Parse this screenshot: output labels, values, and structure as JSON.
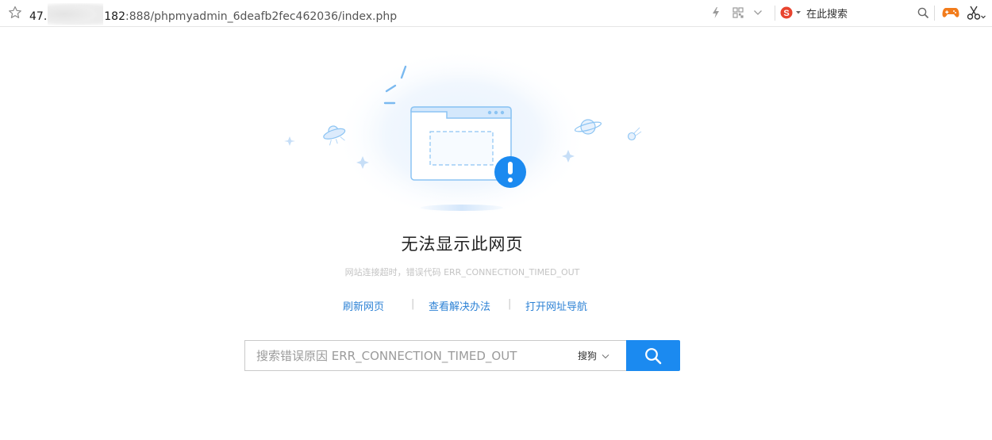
{
  "browser": {
    "url_host_prefix": "47.",
    "url_host_suffix": "182",
    "url_path": ":888/phpmyadmin_6deafb2fec462036/index.php",
    "search_engine_label": "在此搜索",
    "icons": [
      "star-icon",
      "lightning-icon",
      "qr-code-icon",
      "chevron-down-icon",
      "sogou-logo-icon",
      "search-icon",
      "game-controller-icon",
      "scissors-icon"
    ]
  },
  "error_page": {
    "title": "无法显示此网页",
    "subtitle": "网站连接超时，错误代码 ERR_CONNECTION_TIMED_OUT",
    "links": {
      "refresh": "刷新网页",
      "solutions": "查看解决办法",
      "nav": "打开网址导航"
    },
    "separator": "|",
    "search": {
      "placeholder": "搜索错误原因 ERR_CONNECTION_TIMED_OUT",
      "engine": "搜狗"
    }
  },
  "colors": {
    "accent": "#1b8af0",
    "link": "#2d82d5",
    "warning_badge": "#1b8af0"
  }
}
